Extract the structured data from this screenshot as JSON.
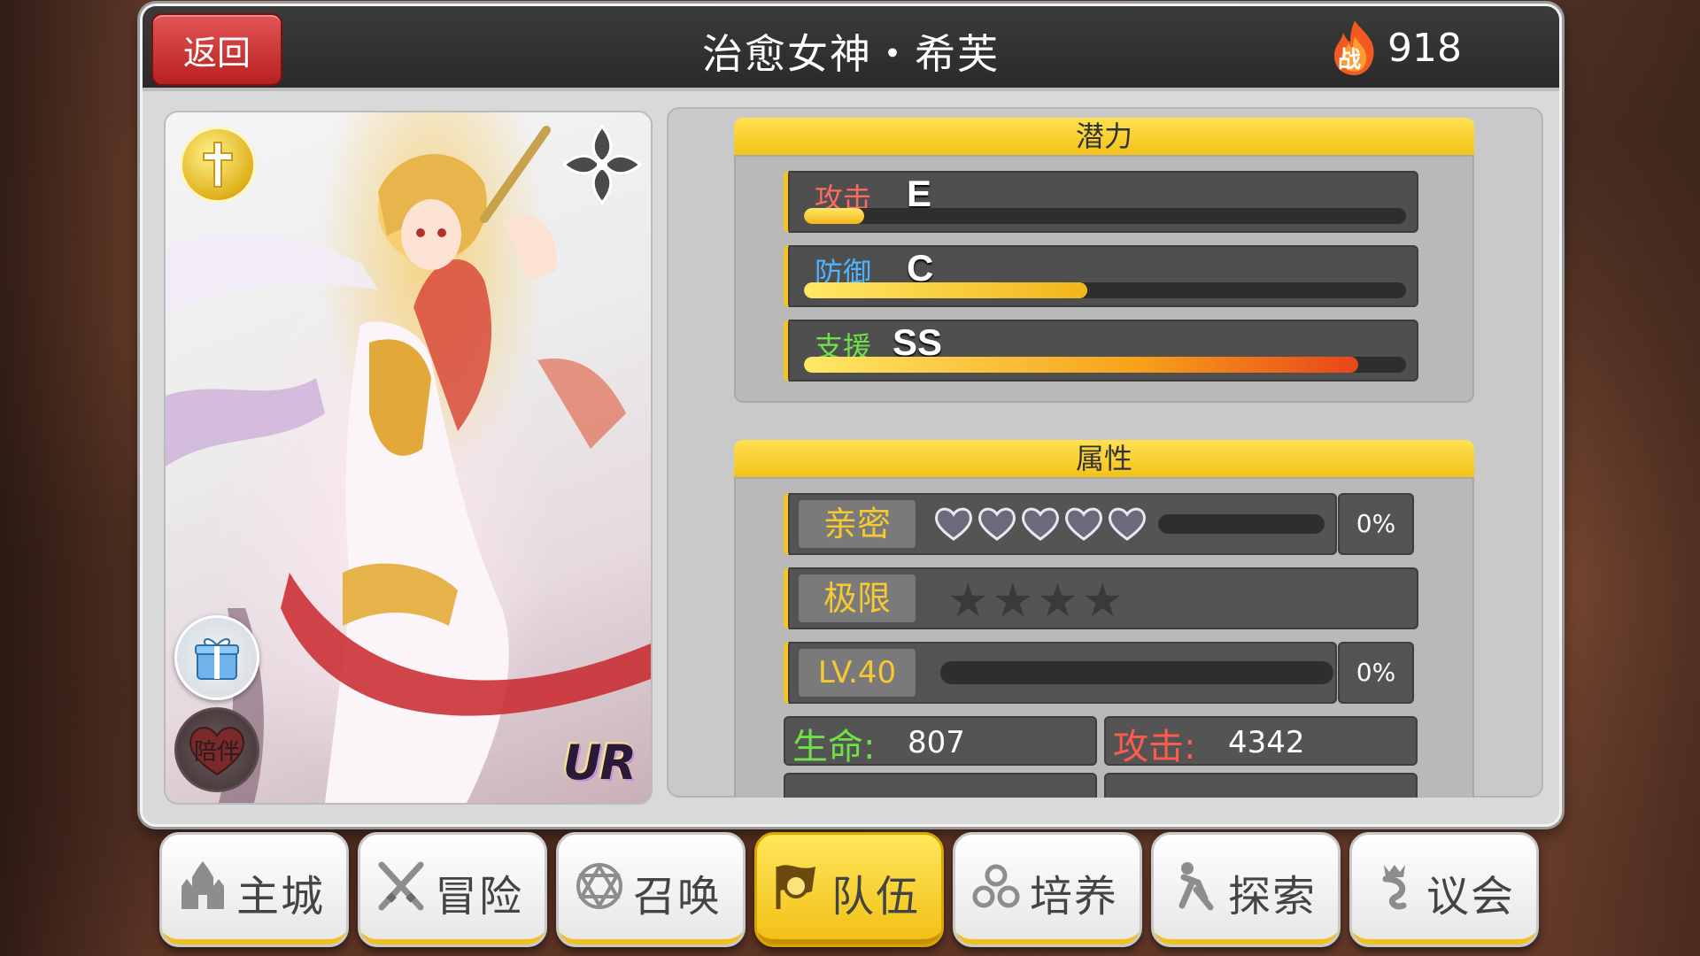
{
  "header": {
    "back_label": "返回",
    "hero_name": "治愈女神・希芙",
    "power_icon_text": "战",
    "power_value": "918"
  },
  "portrait": {
    "rarity": "UR",
    "companion_label": "陪伴",
    "class_icon": "cross-icon",
    "element_icon": "dark-flower-icon"
  },
  "potential": {
    "title": "潜力",
    "rows": [
      {
        "label": "攻击",
        "grade": "E",
        "fill": 0.05,
        "label_color": "#ff6b5e"
      },
      {
        "label": "防御",
        "grade": "C",
        "fill": 0.47,
        "label_color": "#4fb4ff"
      },
      {
        "label": "支援",
        "grade": "SS",
        "fill": 0.92,
        "label_color": "#6fe04a"
      }
    ]
  },
  "attributes": {
    "title": "属性",
    "intimacy": {
      "label": "亲密",
      "hearts": 5,
      "fill": 0.0,
      "percent": "0%"
    },
    "limit": {
      "label": "极限",
      "stars": 4,
      "filled_stars": 0
    },
    "level": {
      "label": "LV.40",
      "fill": 0.0,
      "percent": "0%"
    },
    "stats": [
      {
        "label": "生命:",
        "value": "807",
        "color": "#6fe04a"
      },
      {
        "label": "攻击:",
        "value": "4342",
        "color": "#ff5b4a"
      }
    ]
  },
  "nav": [
    {
      "label": "主城",
      "icon": "castle-icon"
    },
    {
      "label": "冒险",
      "icon": "crossed-swords-icon"
    },
    {
      "label": "召唤",
      "icon": "hexagram-icon"
    },
    {
      "label": "队伍",
      "icon": "team-flag-icon",
      "active": true
    },
    {
      "label": "培养",
      "icon": "bubbles-icon"
    },
    {
      "label": "探索",
      "icon": "explorer-icon"
    },
    {
      "label": "议会",
      "icon": "council-icon"
    }
  ],
  "colors": {
    "accent_yellow": "#f5c51d",
    "back_red": "#d23a3a",
    "panel_dark": "#545454"
  }
}
